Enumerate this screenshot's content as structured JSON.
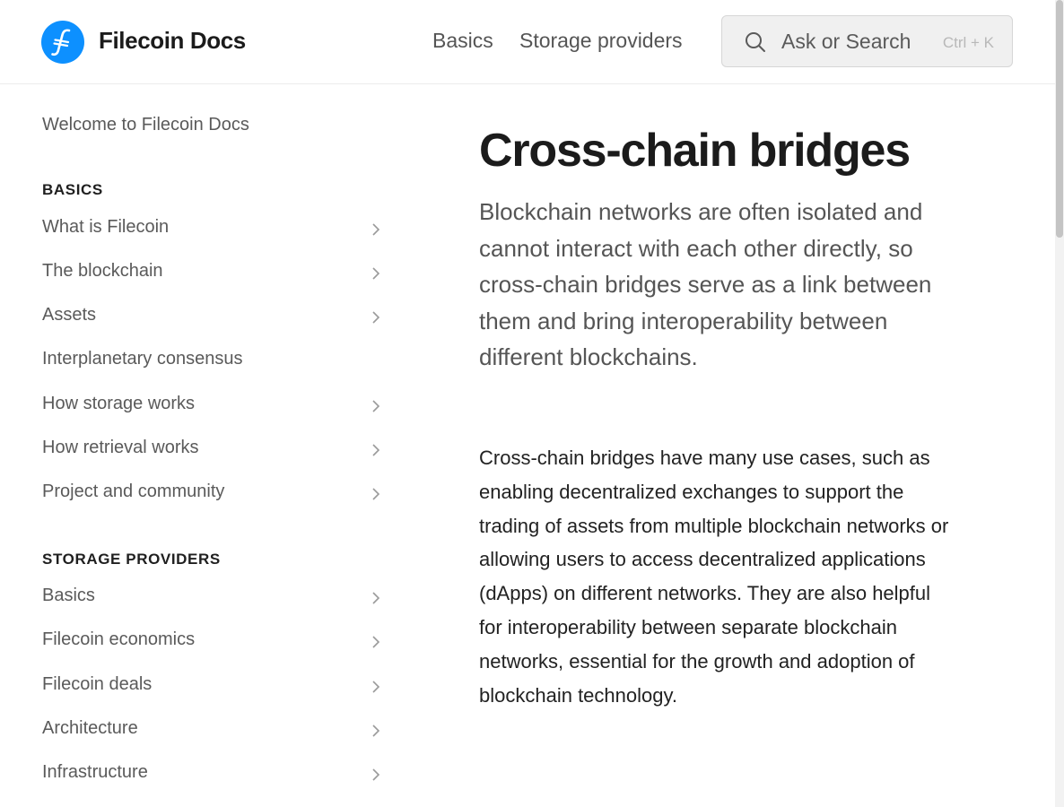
{
  "header": {
    "brand": "Filecoin Docs",
    "logo_icon": "filecoin-logo-icon",
    "nav": [
      "Basics",
      "Storage providers"
    ],
    "search": {
      "placeholder": "Ask or Search",
      "shortcut": "Ctrl + K",
      "icon": "search-icon"
    }
  },
  "sidebar": {
    "welcome": "Welcome to Filecoin Docs",
    "sections": [
      {
        "heading": "BASICS",
        "items": [
          {
            "label": "What is Filecoin",
            "has_children": true
          },
          {
            "label": "The blockchain",
            "has_children": true
          },
          {
            "label": "Assets",
            "has_children": true
          },
          {
            "label": "Interplanetary consensus",
            "has_children": false
          },
          {
            "label": "How storage works",
            "has_children": true
          },
          {
            "label": "How retrieval works",
            "has_children": true
          },
          {
            "label": "Project and community",
            "has_children": true
          }
        ]
      },
      {
        "heading": "STORAGE PROVIDERS",
        "items": [
          {
            "label": "Basics",
            "has_children": true
          },
          {
            "label": "Filecoin economics",
            "has_children": true
          },
          {
            "label": "Filecoin deals",
            "has_children": true
          },
          {
            "label": "Architecture",
            "has_children": true
          },
          {
            "label": "Infrastructure",
            "has_children": true
          }
        ]
      }
    ]
  },
  "main": {
    "title": "Cross-chain bridges",
    "lead": "Blockchain networks are often isolated and cannot interact with each other directly, so cross-chain bridges serve as a link between them and bring interoperability between different blockchains.",
    "paragraph": "Cross-chain bridges have many use cases, such as enabling decentralized exchanges to support the trading of assets from multiple blockchain networks or allowing users to access decentralized applications (dApps) on different networks. They are also helpful for interoperability between separate blockchain networks, essential for the growth and adoption of blockchain technology."
  },
  "colors": {
    "accent": "#0d90ff",
    "text_primary": "#1b1b1b",
    "text_secondary": "#5a5a5a"
  }
}
